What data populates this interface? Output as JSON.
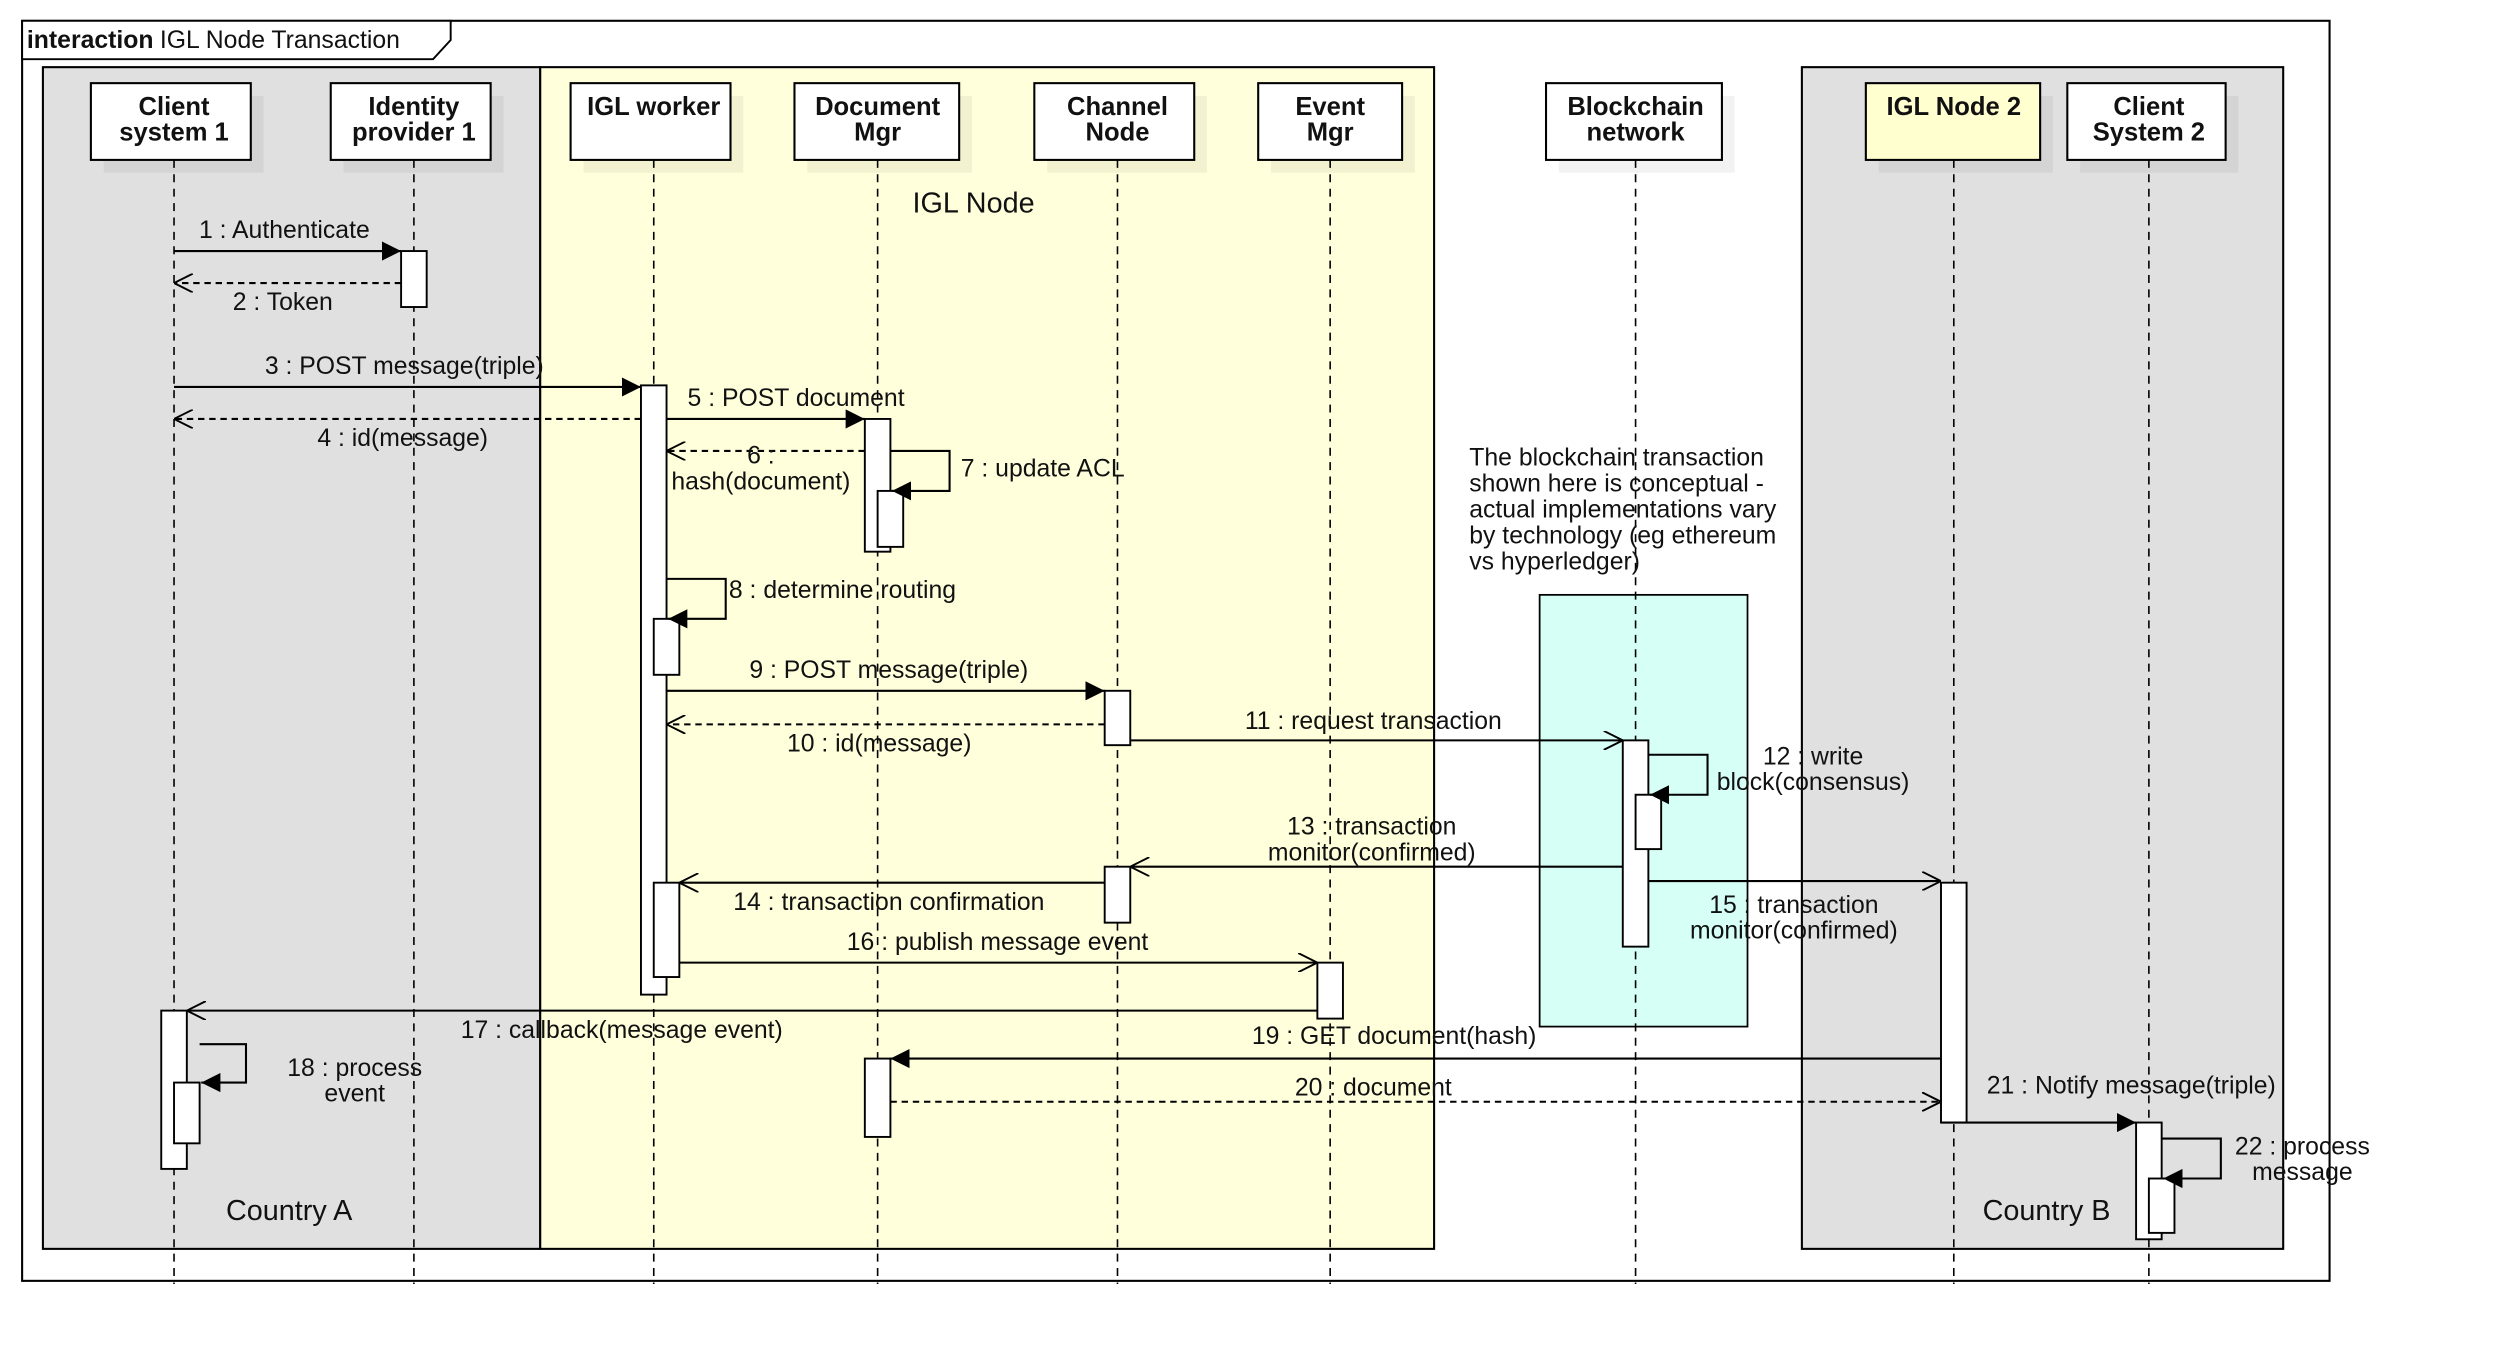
{
  "frame": {
    "keyword": "interaction",
    "title": "IGL Node Transaction"
  },
  "regions": {
    "country_a": "Country A",
    "igl_node": "IGL Node",
    "country_b": "Country B"
  },
  "colors": {
    "country_fill": "#e0e0e0",
    "igl_node_fill": "#ffffdc",
    "blockchain_fill": "#d6fff6",
    "igl_node2_header_fill": "#ffffd0"
  },
  "lifelines": [
    {
      "id": "client1",
      "lines": [
        "Client",
        "system 1"
      ]
    },
    {
      "id": "idp1",
      "lines": [
        "Identity",
        "provider 1"
      ]
    },
    {
      "id": "igl_worker",
      "lines": [
        "IGL worker"
      ]
    },
    {
      "id": "doc_mgr",
      "lines": [
        "Document",
        "Mgr"
      ]
    },
    {
      "id": "channel_node",
      "lines": [
        "Channel",
        "Node"
      ]
    },
    {
      "id": "event_mgr",
      "lines": [
        "Event",
        "Mgr"
      ]
    },
    {
      "id": "blockchain",
      "lines": [
        "Blockchain",
        "network"
      ]
    },
    {
      "id": "igl_node2",
      "lines": [
        "IGL Node 2"
      ]
    },
    {
      "id": "client2",
      "lines": [
        "Client",
        "System 2"
      ]
    }
  ],
  "messages": [
    {
      "n": 1,
      "text": [
        "1 : Authenticate"
      ],
      "type": "sync"
    },
    {
      "n": 2,
      "text": [
        "2 : Token"
      ],
      "type": "reply"
    },
    {
      "n": 3,
      "text": [
        "3 : POST message(triple)"
      ],
      "type": "sync"
    },
    {
      "n": 4,
      "text": [
        "4 : id(message)"
      ],
      "type": "reply"
    },
    {
      "n": 5,
      "text": [
        "5 : POST document"
      ],
      "type": "sync"
    },
    {
      "n": 6,
      "text": [
        "6 :",
        "hash(document)"
      ],
      "type": "reply"
    },
    {
      "n": 7,
      "text": [
        "7 : update ACL"
      ],
      "type": "self"
    },
    {
      "n": 8,
      "text": [
        "8 : determine routing"
      ],
      "type": "self"
    },
    {
      "n": 9,
      "text": [
        "9 : POST message(triple)"
      ],
      "type": "sync"
    },
    {
      "n": 10,
      "text": [
        "10 : id(message)"
      ],
      "type": "reply"
    },
    {
      "n": 11,
      "text": [
        "11 : request transaction"
      ],
      "type": "async"
    },
    {
      "n": 12,
      "text": [
        "12 : write",
        "block(consensus)"
      ],
      "type": "self"
    },
    {
      "n": 13,
      "text": [
        "13 : transaction",
        "monitor(confirmed)"
      ],
      "type": "async"
    },
    {
      "n": 14,
      "text": [
        "14 : transaction confirmation"
      ],
      "type": "async"
    },
    {
      "n": 15,
      "text": [
        "15 : transaction",
        "monitor(confirmed)"
      ],
      "type": "async"
    },
    {
      "n": 16,
      "text": [
        "16 : publish message event"
      ],
      "type": "async"
    },
    {
      "n": 17,
      "text": [
        "17 : callback(message event)"
      ],
      "type": "async"
    },
    {
      "n": 18,
      "text": [
        "18 : process",
        "event"
      ],
      "type": "self"
    },
    {
      "n": 19,
      "text": [
        "19 : GET document(hash)"
      ],
      "type": "sync"
    },
    {
      "n": 20,
      "text": [
        "20 : document"
      ],
      "type": "reply"
    },
    {
      "n": 21,
      "text": [
        "21 : Notify message(triple)"
      ],
      "type": "sync"
    },
    {
      "n": 22,
      "text": [
        "22 : process",
        "message"
      ],
      "type": "self"
    }
  ],
  "note": {
    "lines": [
      "The blockchain transaction",
      "shown here is conceptual -",
      "actual implementations vary",
      "by technology (eg ethereum",
      "vs hyperledger)"
    ]
  }
}
